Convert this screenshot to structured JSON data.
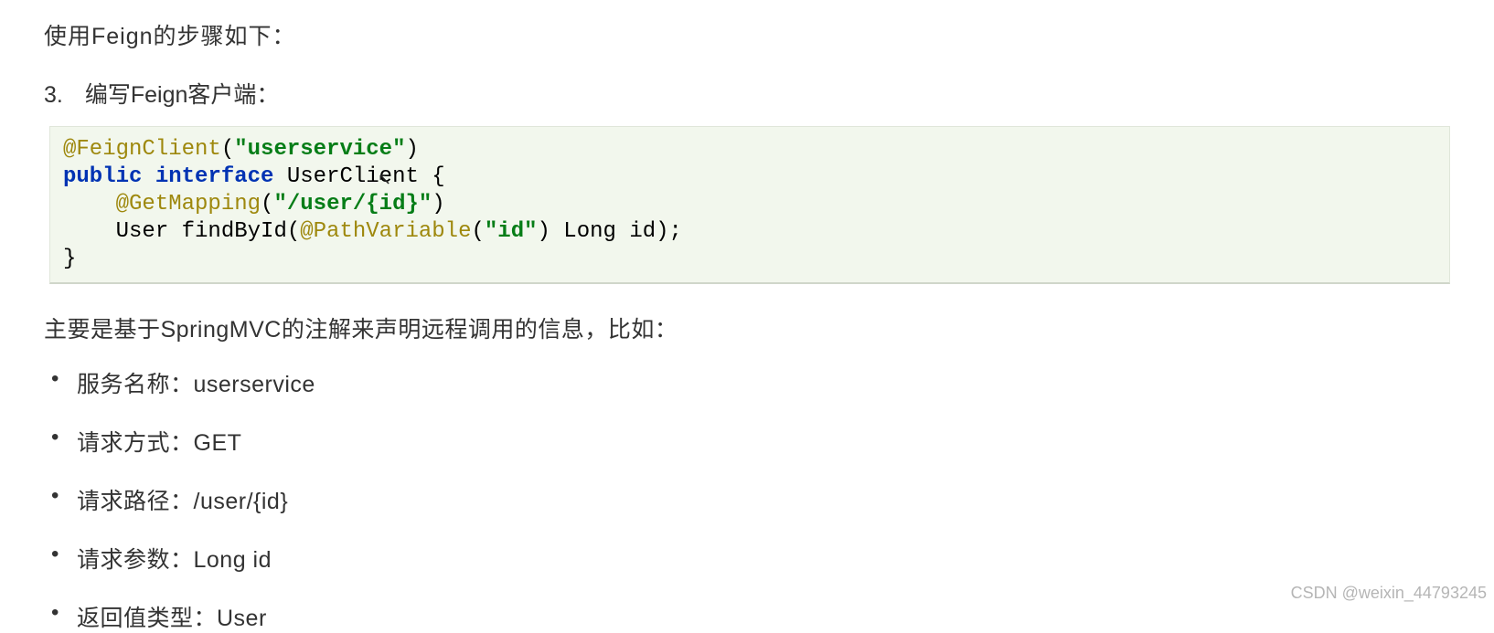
{
  "intro": "使用Feign的步骤如下：",
  "step": {
    "num": "3.",
    "label": "编写Feign客户端："
  },
  "code": {
    "l1a": "@FeignClient",
    "l1b": "(",
    "l1c": "\"userservice\"",
    "l1d": ")",
    "l2a": "public",
    "l2b": " ",
    "l2c": "interface",
    "l2d": " UserClient {",
    "l3a": "    ",
    "l3b": "@GetMapping",
    "l3c": "(",
    "l3d": "\"/user/{id}\"",
    "l3e": ")",
    "l4a": "    User findById(",
    "l4b": "@PathVariable",
    "l4c": "(",
    "l4d": "\"id\"",
    "l4e": ") Long id);",
    "l5": "}"
  },
  "desc": "主要是基于SpringMVC的注解来声明远程调用的信息，比如：",
  "items": [
    "服务名称：userservice",
    "请求方式：GET",
    "请求路径：/user/{id}",
    "请求参数：Long id",
    "返回值类型：User"
  ],
  "watermark": "CSDN @weixin_44793245"
}
